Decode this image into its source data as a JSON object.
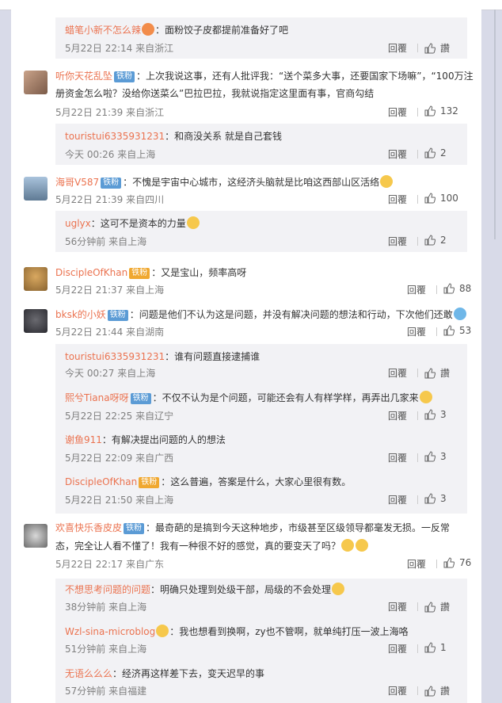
{
  "threads": [
    {
      "kind": "sub",
      "name": "蜡笔小新不怎么辣",
      "fan": "",
      "text": "：面粉饺子皮都提前准备好了吧",
      "meta": "5月22日 22:14 来自浙江",
      "reply": "回覆",
      "like": "讚",
      "emoji_after_name": true
    },
    {
      "kind": "main",
      "name": "听你天花乱坠",
      "fan": "铁粉",
      "text1": "：上次我说这事，还有人批评我：“送个菜多大事，还要国家下场嘛”，“100万注",
      "text2": "册资金怎么啦？没给你送菜么”巴拉巴拉，我就说指定这里面有事，官商勾结",
      "meta": "5月22日 21:39 来自浙江",
      "reply": "回覆",
      "like": "132"
    },
    {
      "kind": "sub",
      "name": "touristui6335931231",
      "fan": "",
      "text": "：和商没关系 就是自己套钱",
      "meta": "今天 00:26 来自上海",
      "reply": "回覆",
      "like": "2"
    },
    {
      "kind": "main",
      "name": "海哥V587",
      "fan": "铁粉",
      "text1": "：不愧是宇宙中心城市，这经济头脑就是比咱这西部山区活络",
      "meta": "5月22日 21:39 来自四川",
      "reply": "回覆",
      "like": "100"
    },
    {
      "kind": "sub",
      "name": "uglyx",
      "fan": "",
      "text": "：这可不是资本的力量",
      "meta": "56分钟前 来自上海",
      "reply": "回覆",
      "like": "2"
    },
    {
      "kind": "main",
      "name": "DiscipleOfKhan",
      "fan": "铁粉",
      "text1": "：又是宝山，频率高呀",
      "meta": "5月22日 21:37 来自上海",
      "reply": "回覆",
      "like": "88"
    },
    {
      "kind": "main",
      "name": "bksk的小妖",
      "fan": "铁粉",
      "text1": "：问题是他们不认为这是问题，并没有解决问题的想法和行动，下次他们还敢",
      "meta": "5月22日 21:44 来自湖南",
      "reply": "回覆",
      "like": "53"
    },
    {
      "kind": "sub",
      "name": "touristui6335931231",
      "fan": "",
      "text": "：谁有问题直接逮捕谁",
      "meta": "今天 00:27 来自上海",
      "reply": "回覆",
      "like": "讚"
    },
    {
      "kind": "sub",
      "name": "熙兮Tiana呀呀",
      "fan": "铁粉",
      "text": "：不仅不认为是个问题，可能还会有人有样学样，再弄出几家来",
      "meta": "5月22日 22:25 来自辽宁",
      "reply": "回覆",
      "like": "3"
    },
    {
      "kind": "sub",
      "name": "谢鱼911",
      "fan": "",
      "text": "：有解决提出问题的人的想法",
      "meta": "5月22日 22:09 来自广西",
      "reply": "回覆",
      "like": "3"
    },
    {
      "kind": "sub",
      "name": "DiscipleOfKhan",
      "fan": "铁粉",
      "text": "：这么普遍，答案是什么，大家心里很有数。",
      "meta": "5月22日 21:50 来自上海",
      "reply": "回覆",
      "like": "3"
    },
    {
      "kind": "main",
      "name": "欢喜快乐香皮皮",
      "fan": "铁粉",
      "text1": "：最奇葩的是搞到今天这种地步，市级甚至区级领导都毫发无损。一反常",
      "text2": "态，完全让人看不懂了！我有一种很不好的感觉，真的要变天了吗？",
      "meta": "5月22日 22:17 来自广东",
      "reply": "回覆",
      "like": "76"
    },
    {
      "kind": "sub",
      "name": "不想思考问题的问题",
      "fan": "",
      "text": "：明确只处理到处级干部，局级的不会处理",
      "meta": "38分钟前 来自上海",
      "reply": "回覆",
      "like": "讚"
    },
    {
      "kind": "sub",
      "name": "Wzl-sina-microblog",
      "fan": "",
      "text": "：我也想看到换啊，zy也不管啊，就单纯打压一波上海咯",
      "meta": "51分钟前 来自上海",
      "reply": "回覆",
      "like": "1"
    },
    {
      "kind": "sub",
      "name": "无语么么么",
      "fan": "",
      "text": "：经济再这样差下去，变天迟早的事",
      "meta": "57分钟前 来自福建",
      "reply": "回覆",
      "like": "讚"
    }
  ]
}
